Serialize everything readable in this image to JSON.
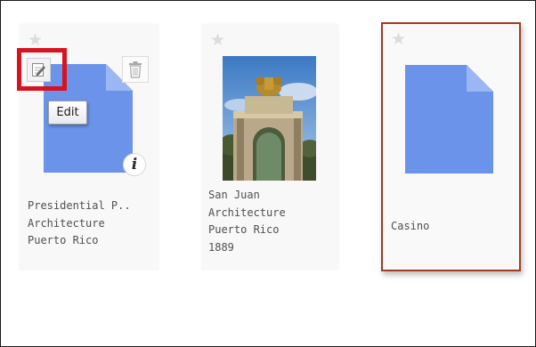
{
  "cards": [
    {
      "label": "Presidential P..\nArchitecture\nPuerto Rico",
      "thumbnail": "blue-document-icon",
      "starred": false
    },
    {
      "label": "San Juan\nArchitecture\nPuerto Rico\n1889",
      "thumbnail": "photo-fountain-monument",
      "starred": false
    },
    {
      "label": "Casino",
      "thumbnail": "blue-document-icon",
      "starred": false,
      "selected": true
    }
  ],
  "actions": {
    "edit_icon": "edit-icon",
    "delete_icon": "trash-icon",
    "info_glyph": "i"
  },
  "tooltip": {
    "text": "Edit"
  },
  "colors": {
    "document_blue": "#6b93ea",
    "selection_border": "#a23b26",
    "highlight_red": "#d8121e",
    "star_grey": "#dcdcdc"
  }
}
